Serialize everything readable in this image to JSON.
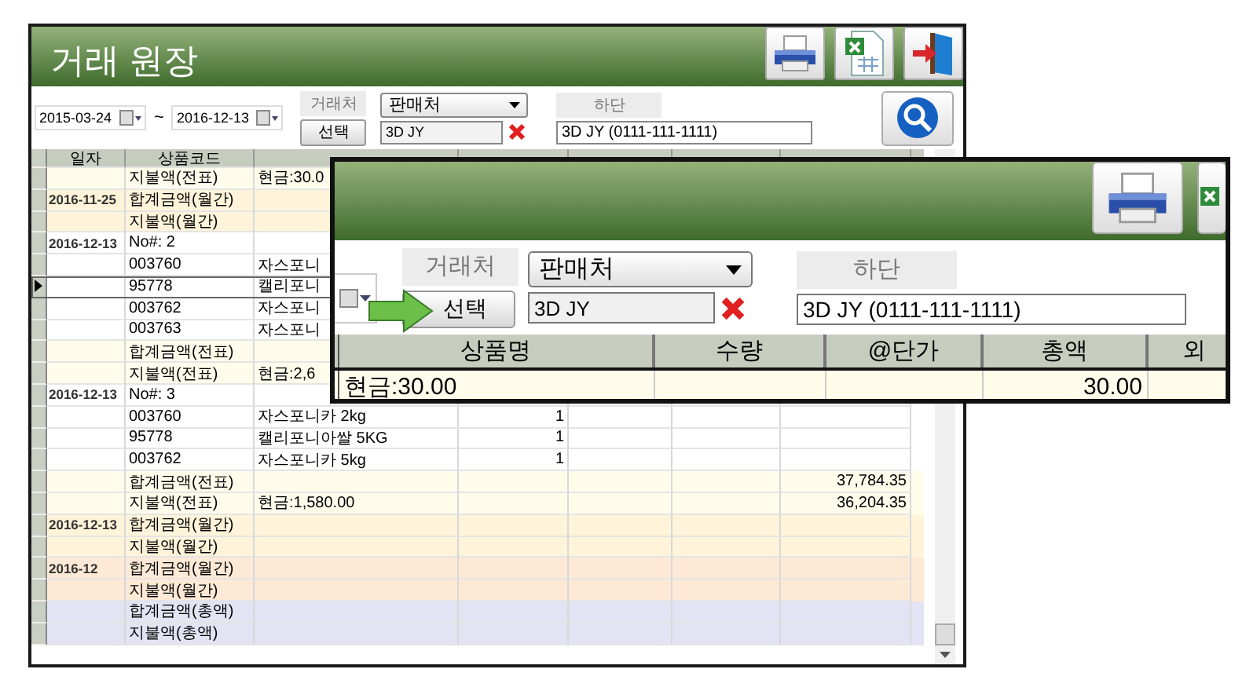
{
  "window": {
    "title": "거래 원장"
  },
  "toolbar": {
    "date_from": "2015-03-24",
    "range_separator": "~",
    "date_to": "2016-12-13",
    "partner_label": "거래처",
    "partner_type": "판매처",
    "select_button": "선택",
    "partner_name": "3D JY",
    "bottom_label": "하단",
    "partner_detail": "3D JY (0111-111-1111)"
  },
  "table": {
    "columns": [
      "일자",
      "상품코드"
    ],
    "rows": [
      {
        "kind": "slip_total",
        "selected": false,
        "cells": [
          "",
          "지불액(전표)",
          "현금:30.0",
          "",
          "",
          "",
          ""
        ]
      },
      {
        "kind": "day_total",
        "selected": false,
        "cells": [
          "2016-11-25",
          "합계금액(월간)",
          "",
          "",
          "",
          "",
          ""
        ]
      },
      {
        "kind": "day_total",
        "selected": false,
        "cells": [
          "",
          "지불액(월간)",
          "",
          "",
          "",
          "",
          ""
        ]
      },
      {
        "kind": "item",
        "selected": false,
        "cells": [
          "2016-12-13",
          "No#: 2",
          "",
          "",
          "",
          "",
          ""
        ]
      },
      {
        "kind": "item",
        "selected": false,
        "cells": [
          "",
          "003760",
          "자스포니",
          "",
          "",
          "",
          ""
        ]
      },
      {
        "kind": "item",
        "selected": true,
        "cells": [
          "",
          "95778",
          "캘리포니",
          "",
          "",
          "",
          ""
        ]
      },
      {
        "kind": "item",
        "selected": false,
        "cells": [
          "",
          "003762",
          "자스포니",
          "",
          "",
          "",
          ""
        ]
      },
      {
        "kind": "item",
        "selected": false,
        "cells": [
          "",
          "003763",
          "자스포니",
          "",
          "",
          "",
          ""
        ]
      },
      {
        "kind": "slip_total",
        "selected": false,
        "cells": [
          "",
          "합계금액(전표)",
          "",
          "",
          "",
          "",
          ""
        ]
      },
      {
        "kind": "slip_total",
        "selected": false,
        "cells": [
          "",
          "지불액(전표)",
          "현금:2,6",
          "",
          "",
          "",
          ""
        ]
      },
      {
        "kind": "item",
        "selected": false,
        "cells": [
          "2016-12-13",
          "No#: 3",
          "",
          "",
          "",
          "",
          ""
        ]
      },
      {
        "kind": "item",
        "selected": false,
        "cells": [
          "",
          "003760",
          "자스포니카 2kg",
          "1",
          "",
          "",
          ""
        ]
      },
      {
        "kind": "item",
        "selected": false,
        "cells": [
          "",
          "95778",
          "캘리포니아쌀 5KG",
          "1",
          "",
          "",
          ""
        ]
      },
      {
        "kind": "item",
        "selected": false,
        "cells": [
          "",
          "003762",
          "자스포니카 5kg",
          "1",
          "",
          "",
          ""
        ]
      },
      {
        "kind": "slip_total",
        "selected": false,
        "cells": [
          "",
          "합계금액(전표)",
          "",
          "",
          "",
          "",
          "37,784.35"
        ]
      },
      {
        "kind": "slip_total",
        "selected": false,
        "cells": [
          "",
          "지불액(전표)",
          "현금:1,580.00",
          "",
          "",
          "",
          "36,204.35"
        ]
      },
      {
        "kind": "day_total",
        "selected": false,
        "cells": [
          "2016-12-13",
          "합계금액(월간)",
          "",
          "",
          "",
          "",
          ""
        ]
      },
      {
        "kind": "day_total",
        "selected": false,
        "cells": [
          "",
          "지불액(월간)",
          "",
          "",
          "",
          "",
          ""
        ]
      },
      {
        "kind": "month_total",
        "selected": false,
        "cells": [
          "2016-12",
          "합계금액(월간)",
          "",
          "",
          "",
          "",
          ""
        ]
      },
      {
        "kind": "month_total",
        "selected": false,
        "cells": [
          "",
          "지불액(월간)",
          "",
          "",
          "",
          "",
          ""
        ]
      },
      {
        "kind": "grand_total",
        "selected": false,
        "cells": [
          "",
          "합계금액(총액)",
          "",
          "",
          "",
          "",
          ""
        ]
      },
      {
        "kind": "grand_total",
        "selected": false,
        "cells": [
          "",
          "지불액(총액)",
          "",
          "",
          "",
          "",
          ""
        ]
      }
    ]
  },
  "zoom": {
    "toolbar": {
      "partner_label": "거래처",
      "partner_type": "판매처",
      "select_button": "선택",
      "partner_name": "3D JY",
      "bottom_label": "하단",
      "partner_detail": "3D JY (0111-111-1111)"
    },
    "columns": [
      "상품명",
      "수량",
      "@단가",
      "총액",
      "외"
    ],
    "row": {
      "product_name": "현금:30.00",
      "total": "30.00"
    }
  }
}
